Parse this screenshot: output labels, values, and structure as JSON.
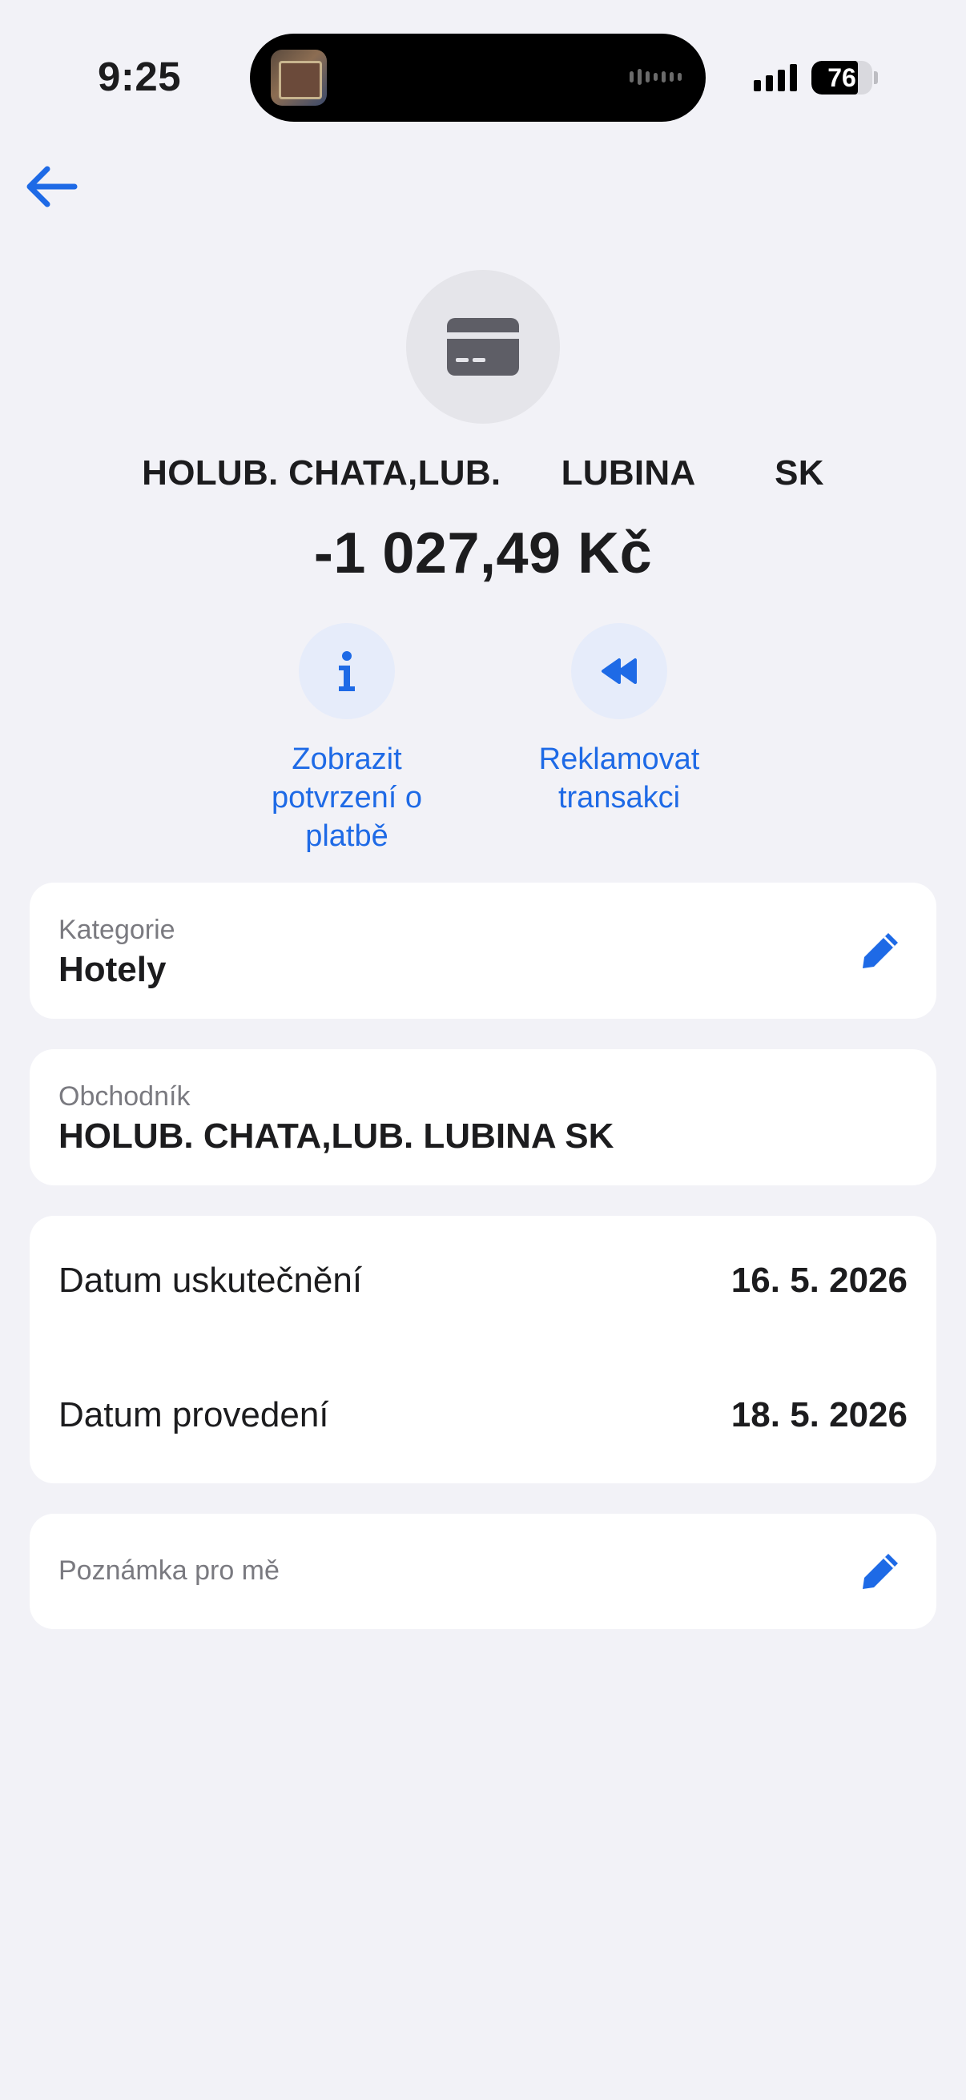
{
  "status_bar": {
    "time": "9:25",
    "battery": "76",
    "battery_level": 0.76
  },
  "header": {
    "merchant_name": "HOLUB. CHATA,LUB.      LUBINA        SK",
    "amount": "-1 027,49 Kč"
  },
  "actions": [
    {
      "label": "Zobrazit potvrzení o platbě",
      "icon": "info-icon"
    },
    {
      "label": "Reklamovat transakci",
      "icon": "rewind-icon"
    }
  ],
  "category": {
    "label": "Kategorie",
    "value": "Hotely"
  },
  "merchant": {
    "label": "Obchodník",
    "value": "HOLUB. CHATA,LUB. LUBINA SK"
  },
  "dates": {
    "executed_label": "Datum uskutečnění",
    "executed_value": "16. 5. 2026",
    "processed_label": "Datum provedení",
    "processed_value": "18. 5. 2026"
  },
  "note": {
    "placeholder": "Poznámka pro mě"
  },
  "colors": {
    "accent": "#1e6ae6",
    "background": "#f2f2f7",
    "card": "#ffffff"
  }
}
